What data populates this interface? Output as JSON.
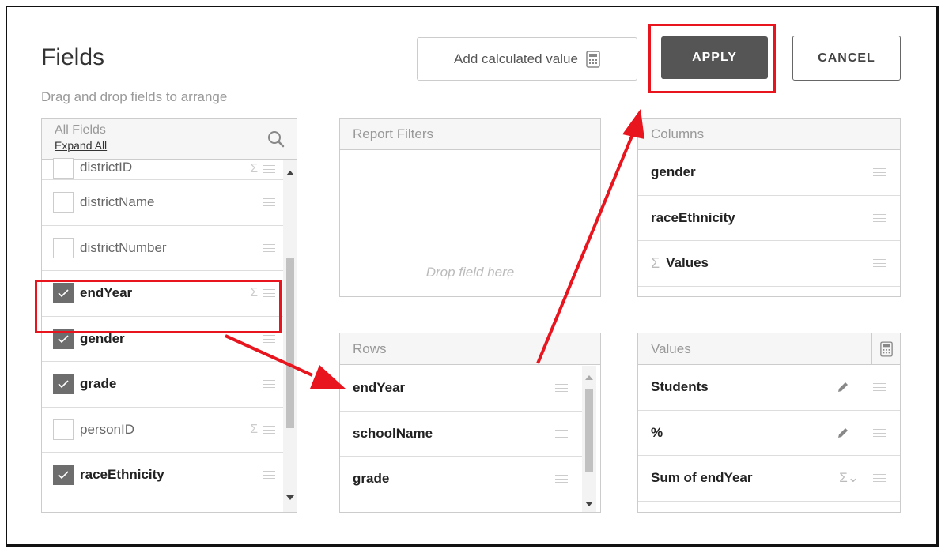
{
  "header": {
    "title": "Fields",
    "subtitle": "Drag and drop fields to arrange",
    "calc_label": "Add calculated value",
    "apply_label": "APPLY",
    "cancel_label": "CANCEL"
  },
  "all_fields": {
    "title": "All Fields",
    "expand_label": "Expand All",
    "items": [
      {
        "label": "districtID",
        "checked": false,
        "sigma": true
      },
      {
        "label": "districtName",
        "checked": false,
        "sigma": false
      },
      {
        "label": "districtNumber",
        "checked": false,
        "sigma": false
      },
      {
        "label": "endYear",
        "checked": true,
        "sigma": true
      },
      {
        "label": "gender",
        "checked": true,
        "sigma": false
      },
      {
        "label": "grade",
        "checked": true,
        "sigma": false
      },
      {
        "label": "personID",
        "checked": false,
        "sigma": true
      },
      {
        "label": "raceEthnicity",
        "checked": true,
        "sigma": false
      }
    ]
  },
  "report_filters": {
    "title": "Report Filters",
    "drop_hint": "Drop field here"
  },
  "columns": {
    "title": "Columns",
    "items": [
      "gender",
      "raceEthnicity",
      "Values"
    ]
  },
  "rows": {
    "title": "Rows",
    "items": [
      "endYear",
      "schoolName",
      "grade"
    ]
  },
  "values": {
    "title": "Values",
    "items": [
      "Students",
      "%",
      "Sum of endYear"
    ]
  },
  "colors": {
    "highlight": "#e8141e",
    "apply_bg": "#555555",
    "checkbox_checked": "#6d6d6d"
  }
}
